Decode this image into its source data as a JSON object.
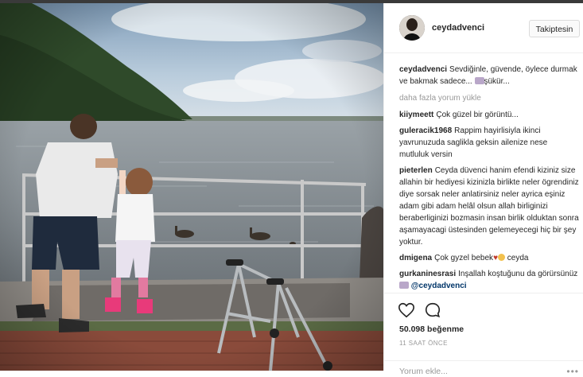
{
  "post": {
    "username": "ceydadvenci",
    "follow_label": "Takiptesin",
    "caption_user": "ceydadvenci",
    "caption_text": "Sevdiğinle, güvende, öylece durmak ve bakmak sadece...",
    "caption_tail": "şükür...",
    "load_more": "daha fazla yorum yükle",
    "likes": "50.098 beğenme",
    "time": "11 SAAT ÖNCE",
    "add_comment_placeholder": "Yorum ekle...",
    "more_options": "•••"
  },
  "comments": [
    {
      "user": "kiiymeett",
      "text": "Çok güzel bir görüntü..."
    },
    {
      "user": "guleracik1968",
      "text": "Rappim hayirlisiyla ikinci yavrunuzuda saglikla geksin ailenize nese mutluluk versin"
    },
    {
      "user": "pieterlen",
      "text": "Ceyda düvenci hanim efendi kiziniz size allahin bir hediyesi kizinizla birlikte neler ögrendiniz diye sorsak neler anlatirsiniz neler ayrica eşiniz adam gibi adam helâl olsun allah birliginizi beraberliginizi bozmasin insan birlik olduktan sonra aşamayacagi üstesinden gelemeyecegi hiç bir şey yoktur."
    },
    {
      "user": "dmigena",
      "text": "Çok gyzel bebek",
      "tail": "ceyda"
    },
    {
      "user": "gurkaninesrasi",
      "text": "Inşallah koştuğunu da görürsünüz",
      "mention": "@ceydadvenci"
    }
  ],
  "colors": {
    "sky": "#a9c1d8",
    "water": "#8a9298",
    "forest": "#2f4a2a",
    "railing": "#c9c9c9",
    "text_muted": "#999999"
  },
  "icons": [
    "heart-icon",
    "comment-icon",
    "more-options-icon"
  ]
}
